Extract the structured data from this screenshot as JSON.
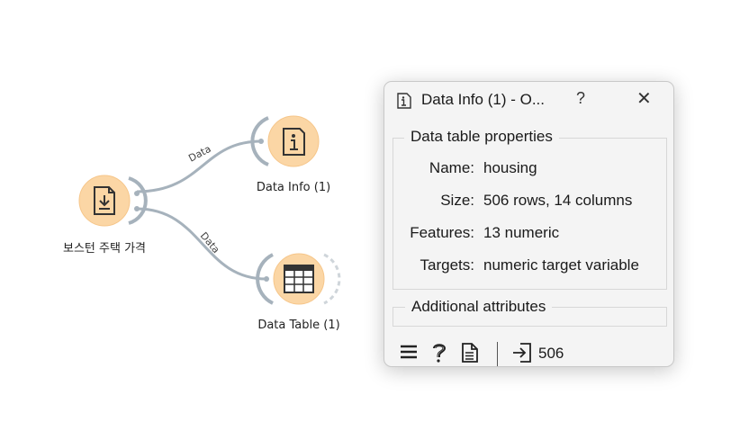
{
  "canvas": {
    "nodes": [
      {
        "id": "file",
        "label": "보스턴 주택 가격",
        "icon": "file-download-icon"
      },
      {
        "id": "datainfo",
        "label": "Data Info (1)",
        "icon": "info-icon"
      },
      {
        "id": "datatable",
        "label": "Data Table (1)",
        "icon": "table-icon"
      }
    ],
    "links": [
      {
        "label": "Data"
      },
      {
        "label": "Data"
      }
    ]
  },
  "popup": {
    "title": "Data Info (1) - O...",
    "help_label": "?",
    "close_label": "✕",
    "section_title": "Data table properties",
    "properties": [
      {
        "key": "Name:",
        "value": "housing"
      },
      {
        "key": "Size:",
        "value": "506 rows, 14 columns"
      },
      {
        "key": "Features:",
        "value": "13 numeric"
      },
      {
        "key": "Targets:",
        "value": "numeric target variable"
      }
    ],
    "additional_title": "Additional attributes",
    "status": {
      "icons": [
        "menu-icon",
        "help-icon",
        "report-icon",
        "input-icon"
      ],
      "input_count": "506"
    }
  },
  "colors": {
    "node_fill": "#fbd6a5",
    "node_border": "#f6c68a",
    "link": "#a6b2bc",
    "icon_dark": "#333333"
  }
}
